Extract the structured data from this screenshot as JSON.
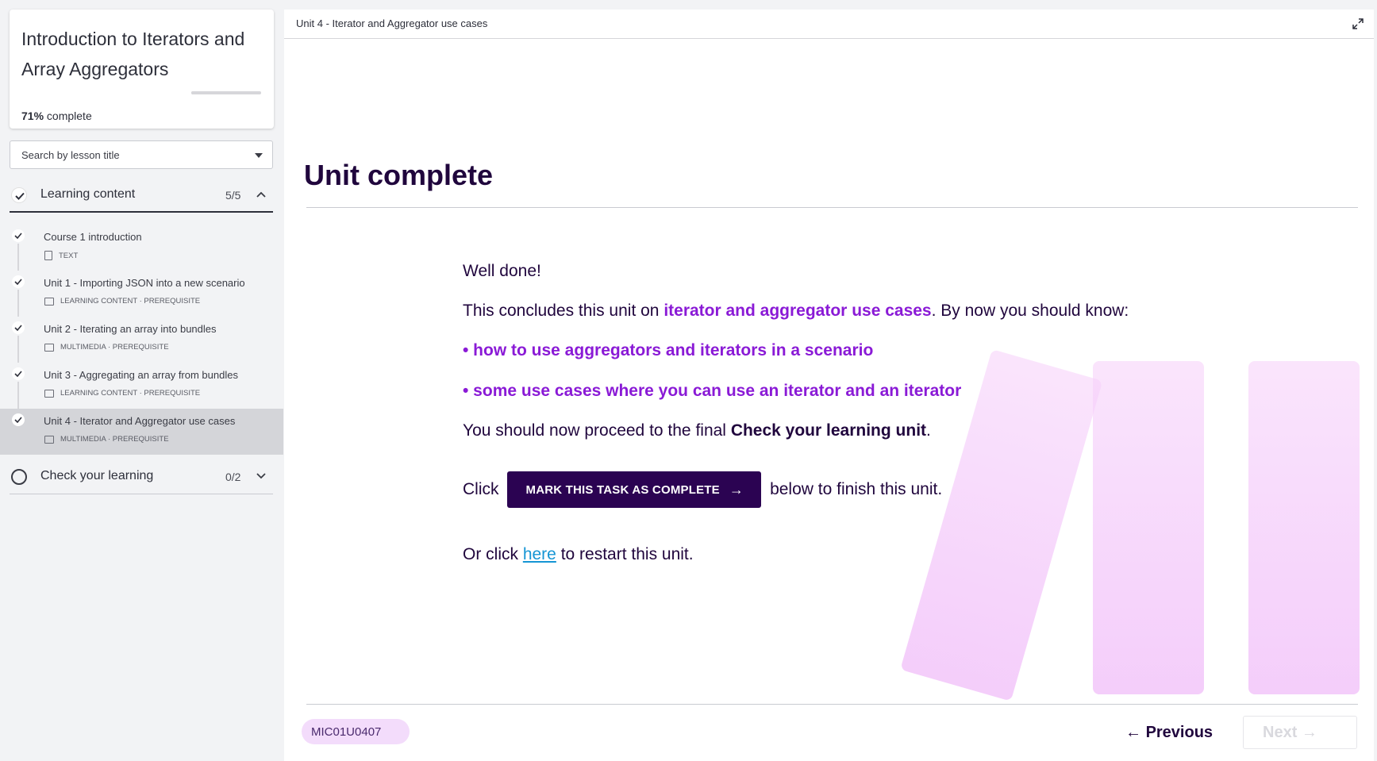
{
  "course": {
    "title": "Introduction to Iterators and Array Aggregators",
    "progress_percent": "71%",
    "progress_suffix": "complete",
    "progress_value": 0.71
  },
  "search": {
    "placeholder": "Search by lesson title"
  },
  "sections": [
    {
      "label": "Learning content",
      "count": "5/5",
      "expanded": true,
      "complete": true
    },
    {
      "label": "Check your learning",
      "count": "0/2",
      "expanded": false,
      "complete": false
    }
  ],
  "lessons": [
    {
      "title": "Course 1 introduction",
      "meta": "TEXT",
      "icon": "document-icon",
      "active": false
    },
    {
      "title": "Unit 1 - Importing JSON into a new scenario",
      "meta": "LEARNING CONTENT · PREREQUISITE",
      "icon": "media-icon",
      "active": false
    },
    {
      "title": "Unit 2 - Iterating an array into bundles",
      "meta": "MULTIMEDIA · PREREQUISITE",
      "icon": "media-icon",
      "active": false
    },
    {
      "title": "Unit 3 - Aggregating an array from bundles",
      "meta": "LEARNING CONTENT · PREREQUISITE",
      "icon": "media-icon",
      "active": false
    },
    {
      "title": "Unit 4 - Iterator and Aggregator use cases",
      "meta": "MULTIMEDIA · PREREQUISITE",
      "icon": "media-icon",
      "active": true
    }
  ],
  "main": {
    "breadcrumb": "Unit 4 - Iterator and Aggregator use cases",
    "heading": "Unit complete",
    "well_done": "Well done!",
    "conclude_prefix": "This concludes this unit on ",
    "conclude_topic": "iterator and aggregator use cases",
    "conclude_suffix": ". By now you should know:",
    "bullet1": "• how to use aggregators and iterators in a scenario",
    "bullet2": "• some use cases where you can use an iterator and an iterator",
    "proceed_prefix": "You should now proceed to the final ",
    "proceed_bold": "Check your learning unit",
    "proceed_suffix": ".",
    "click_prefix": "Click",
    "cta_label": "MARK THIS TASK AS COMPLETE",
    "click_suffix": "below to finish this unit.",
    "restart_prefix": "Or click ",
    "restart_link": "here",
    "restart_suffix": " to restart this unit."
  },
  "footer": {
    "code": "MIC01U0407",
    "previous": "Previous",
    "next": "Next"
  },
  "colors": {
    "brand_dark": "#2b0352",
    "accent_purple": "#8a1ad6",
    "link": "#1595d4"
  }
}
